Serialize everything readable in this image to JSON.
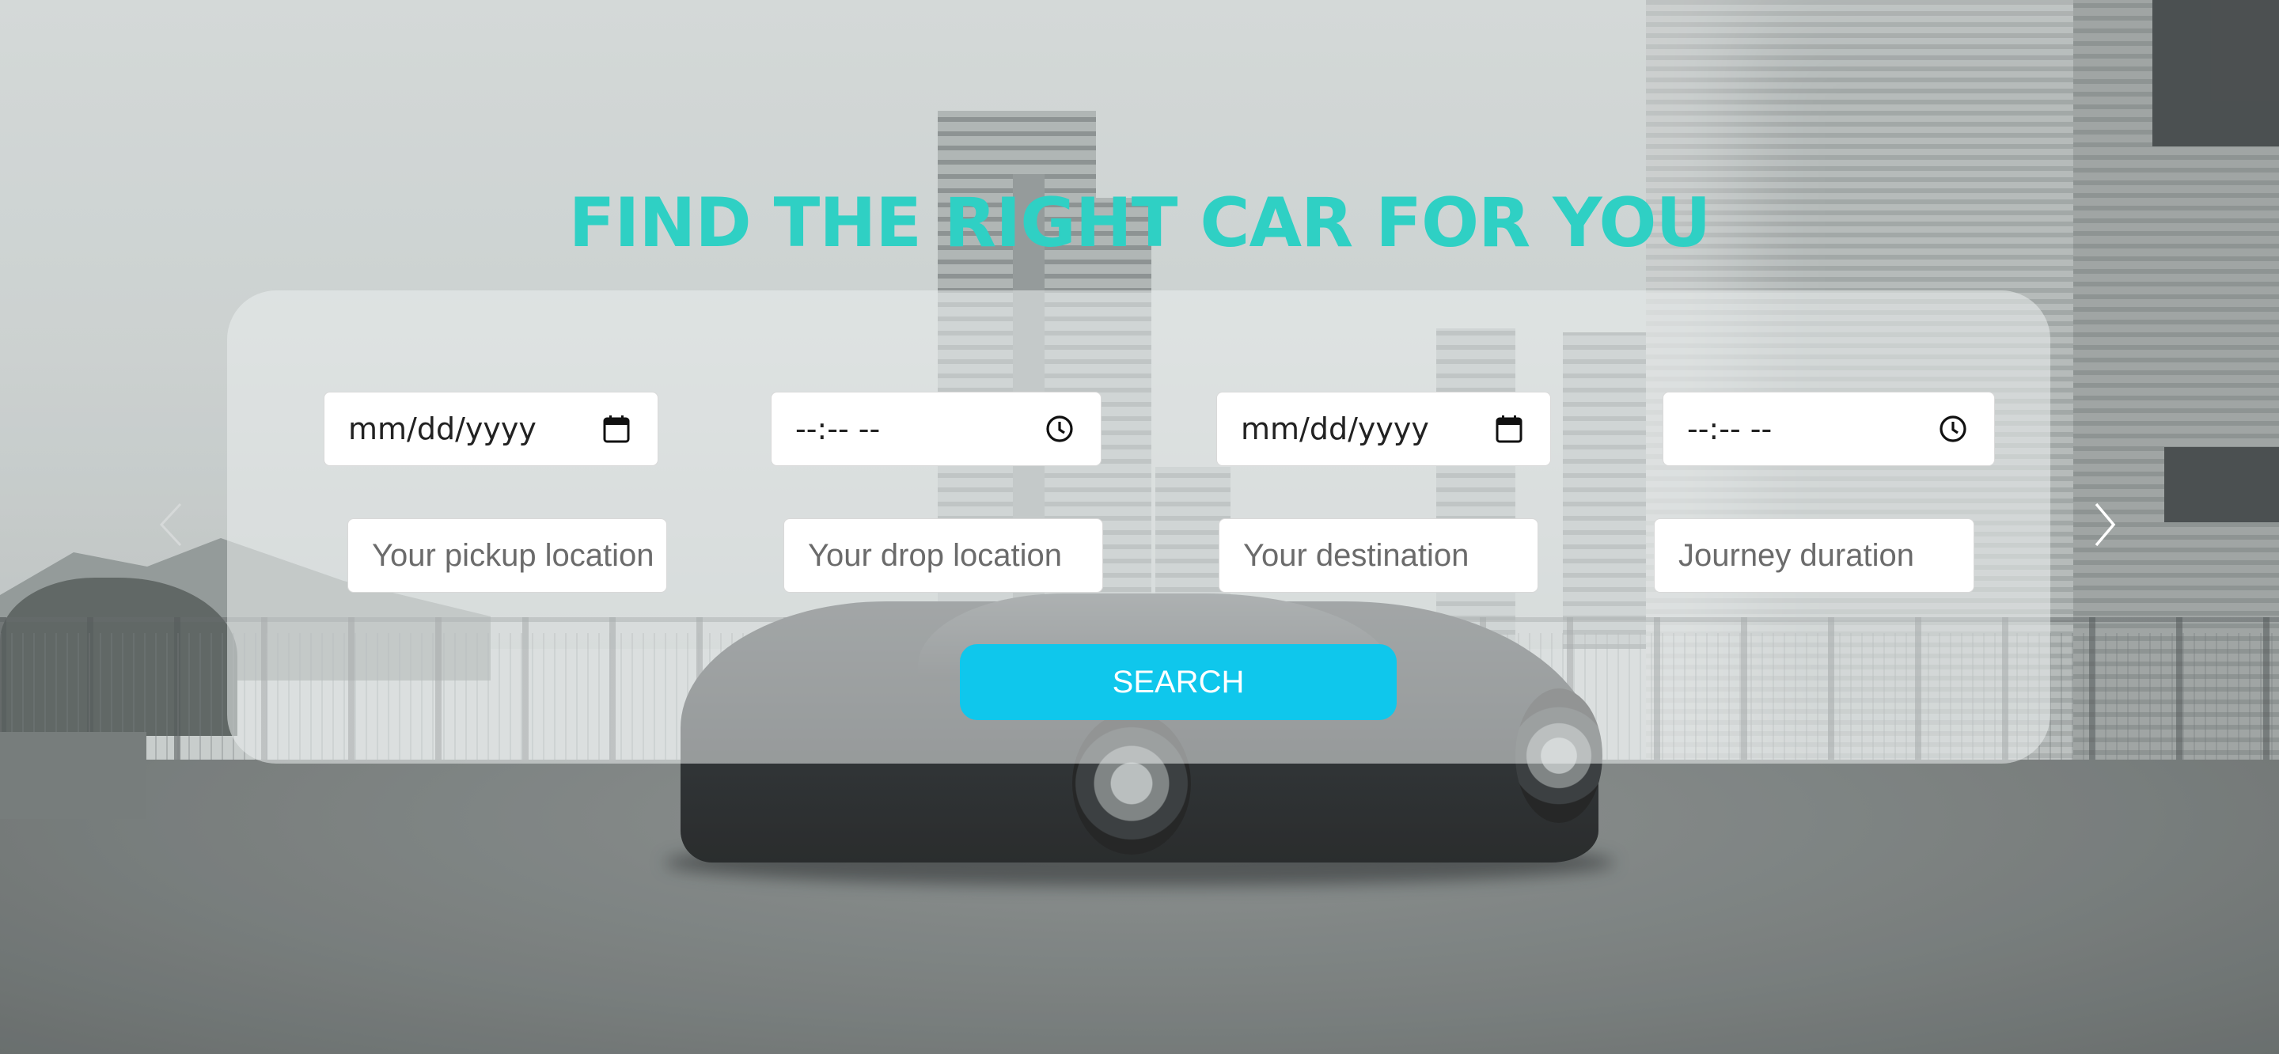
{
  "hero": {
    "title": "FIND THE RIGHT CAR FOR YOU"
  },
  "search_form": {
    "pickup_date": {
      "value": "mm/dd/yyyy",
      "icon": "calendar-icon"
    },
    "pickup_time": {
      "value": "--:-- --",
      "icon": "clock-icon"
    },
    "return_date": {
      "value": "mm/dd/yyyy",
      "icon": "calendar-icon"
    },
    "return_time": {
      "value": "--:-- --",
      "icon": "clock-icon"
    },
    "pickup_location": {
      "placeholder": "Your pickup location"
    },
    "drop_location": {
      "placeholder": "Your drop location"
    },
    "destination": {
      "placeholder": "Your destination"
    },
    "journey_duration": {
      "placeholder": "Journey duration"
    },
    "search_label": "SEARCH"
  },
  "carousel": {
    "prev_icon": "chevron-left-icon",
    "next_icon": "chevron-right-icon"
  },
  "colors": {
    "title": "#2fd0c4",
    "button": "#0fc7ec",
    "panel": "rgba(235,238,238,0.55)"
  }
}
